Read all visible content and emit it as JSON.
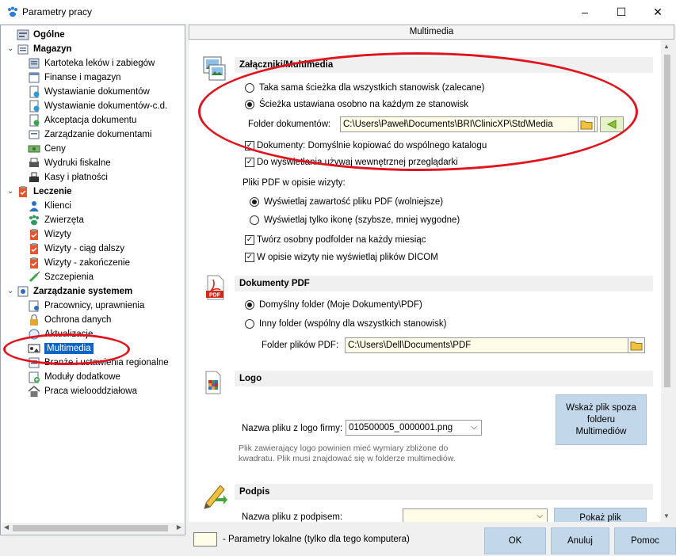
{
  "window": {
    "title": "Parametry pracy",
    "minimize": "–",
    "maximize": "☐",
    "close": "✕"
  },
  "tree": {
    "items": [
      {
        "label": "Ogólne",
        "level": 0,
        "category": true,
        "icon": "settings-icon"
      },
      {
        "label": "Magazyn",
        "level": 0,
        "category": true,
        "expanded": true
      },
      {
        "label": "Kartoteka leków i zabiegów",
        "level": 1,
        "icon": "drug-catalog-icon"
      },
      {
        "label": "Finanse i magazyn",
        "level": 1,
        "icon": "finance-icon"
      },
      {
        "label": "Wystawianie dokumentów",
        "level": 1,
        "icon": "document-issue-icon"
      },
      {
        "label": "Wystawianie dokumentów-c.d.",
        "level": 1,
        "icon": "document-issue-cont-icon"
      },
      {
        "label": "Akceptacja dokumentu",
        "level": 1,
        "icon": "document-accept-icon"
      },
      {
        "label": "Zarządzanie dokumentami",
        "level": 1,
        "icon": "document-manage-icon"
      },
      {
        "label": "Ceny",
        "level": 1,
        "icon": "prices-icon"
      },
      {
        "label": "Wydruki fiskalne",
        "level": 1,
        "icon": "fiscal-printer-icon"
      },
      {
        "label": "Kasy i płatności",
        "level": 1,
        "icon": "cash-register-icon"
      },
      {
        "label": "Leczenie",
        "level": 0,
        "category": true,
        "expanded": true
      },
      {
        "label": "Klienci",
        "level": 1,
        "icon": "clients-icon"
      },
      {
        "label": "Zwierzęta",
        "level": 1,
        "icon": "paw-icon"
      },
      {
        "label": "Wizyty",
        "level": 1,
        "icon": "visits-icon"
      },
      {
        "label": "Wizyty - ciąg dalszy",
        "level": 1,
        "icon": "visits-cont-icon"
      },
      {
        "label": "Wizyty - zakończenie",
        "level": 1,
        "icon": "visits-end-icon"
      },
      {
        "label": "Szczepienia",
        "level": 1,
        "icon": "syringe-icon"
      },
      {
        "label": "Zarządzanie systemem",
        "level": 0,
        "category": true,
        "expanded": true
      },
      {
        "label": "Pracownicy, uprawnienia",
        "level": 1,
        "icon": "employees-icon"
      },
      {
        "label": "Ochrona danych",
        "level": 1,
        "icon": "lock-icon"
      },
      {
        "label": "Aktualizacje",
        "level": 1,
        "icon": "update-icon"
      },
      {
        "label": "Multimedia",
        "level": 1,
        "icon": "multimedia-icon",
        "selected": true
      },
      {
        "label": "Branże i ustawienia regionalne",
        "level": 1,
        "icon": "regional-icon"
      },
      {
        "label": "Moduły dodatkowe",
        "level": 1,
        "icon": "modules-icon"
      },
      {
        "label": "Praca wielooddziałowa",
        "level": 1,
        "icon": "house-icon"
      }
    ]
  },
  "panel": {
    "header": "Multimedia",
    "attachments": {
      "title": "Załączniki/Multimedia",
      "radio_same_path": "Taka sama ścieżka dla wszystkich stanowisk (zalecane)",
      "radio_separate_path": "Ścieżka ustawiana osobno na każdym ze stanowisk",
      "selected_path_option": "separate",
      "folder_label": "Folder dokumentów:",
      "folder_value": "C:\\Users\\Paweł\\Documents\\BRI\\ClinicXP\\Std\\Media",
      "check_copy_label": "Dokumenty: Domyślnie kopiować do wspólnego katalogu",
      "check_copy": true,
      "check_viewer_label": "Do wyświetlania używaj wewnętrznej przeglądarki",
      "check_viewer": true,
      "pdf_group_label": "Pliki PDF w opisie wizyty:",
      "radio_show_content": "Wyświetlaj zawartość pliku PDF (wolniejsze)",
      "radio_show_icon": "Wyświetlaj tylko ikonę (szybsze, mniej wygodne)",
      "selected_pdf_option": "content",
      "check_subfolder_label": "Twórz osobny podfolder na każdy miesiąc",
      "check_subfolder": true,
      "check_dicom_label": "W opisie wizyty nie wyświetlaj plików DICOM",
      "check_dicom": true
    },
    "pdf_docs": {
      "title": "Dokumenty PDF",
      "radio_default": "Domyślny folder (Moje Dokumenty\\PDF)",
      "radio_other": "Inny folder (wspólny dla wszystkich stanowisk)",
      "selected_option": "default",
      "folder_label": "Folder plików PDF:",
      "folder_value": "C:\\Users\\Dell\\Documents\\PDF"
    },
    "logo": {
      "title": "Logo",
      "file_label": "Nazwa pliku z logo firmy:",
      "file_value": "010500005_0000001.png",
      "browse_button": "Wskaż plik spoza folderu Multimediów",
      "hint": "Plik zawierający logo powinien mieć wymiary zbliżone do kwadratu. Plik musi znajdować się w folderze multimediów."
    },
    "signature": {
      "title": "Podpis",
      "file_label": "Nazwa pliku z podpisem:",
      "file_value": "",
      "show_button": "Pokaż plik"
    }
  },
  "footer": {
    "legend": "- Parametry lokalne (tylko dla tego komputera)",
    "ok": "OK",
    "cancel": "Anuluj",
    "help": "Pomoc"
  },
  "colors": {
    "selection": "#0a64c8",
    "local_field": "#fffde8",
    "button": "#c3d7ea",
    "annotation": "#e0141e"
  }
}
